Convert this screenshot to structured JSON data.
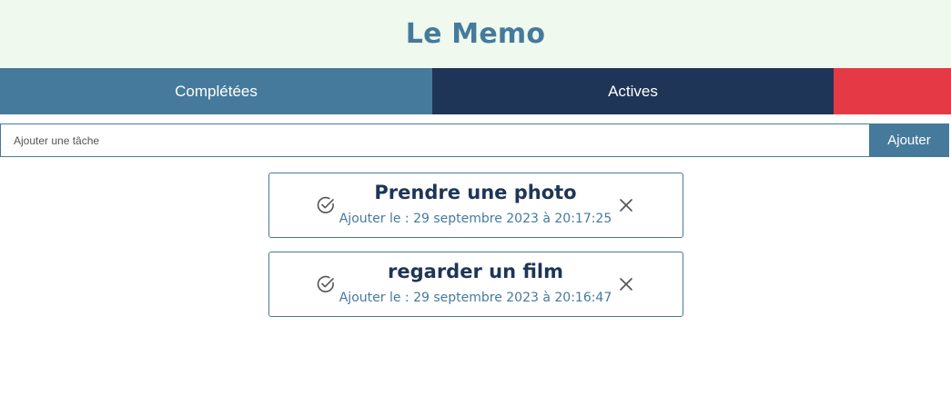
{
  "header": {
    "title": "Le Memo"
  },
  "tabs": {
    "completed": "Complétées",
    "active": "Actives",
    "delete": ""
  },
  "add_task": {
    "placeholder": "Ajouter une tâche",
    "value": "",
    "button_label": "Ajouter"
  },
  "tasks": [
    {
      "title": "Prendre une photo",
      "date": "Ajouter le : 29 septembre 2023 à 20:17:25",
      "complete_icon": "check-circle-icon",
      "delete_icon": "close-icon"
    },
    {
      "title": "regarder un film",
      "date": "Ajouter le : 29 septembre 2023 à 20:16:47",
      "complete_icon": "check-circle-icon",
      "delete_icon": "close-icon"
    }
  ],
  "colors": {
    "header_bg": "#eff9ee",
    "primary": "#467a9c",
    "dark": "#1e3557",
    "danger": "#e63946"
  }
}
